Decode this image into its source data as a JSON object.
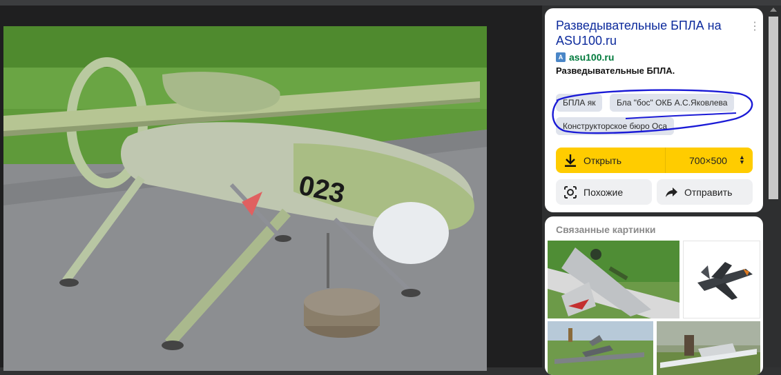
{
  "viewer": {
    "image_name": "uav-photo",
    "aircraft_number": "023"
  },
  "panel": {
    "title": "Разведывательные БПЛА на ASU100.ru",
    "site_name": "asu100.ru",
    "subtitle": "Разведывательные БПЛА.",
    "more_icon": "kebab-icon",
    "tags": [
      "БПЛА як",
      "Бла \"бос\" ОКБ А.С.Яковлева",
      "Конструкторское бюро Оса"
    ],
    "open_label": "Открыть",
    "size_label": "700×500",
    "similar_label": "Похожие",
    "share_label": "Отправить"
  },
  "related": {
    "title": "Связанные картинки"
  },
  "colors": {
    "accent": "#ffcc00",
    "title_link": "#0c2a9c",
    "site_green": "#007a3c",
    "annotation": "#1a1ad6"
  }
}
